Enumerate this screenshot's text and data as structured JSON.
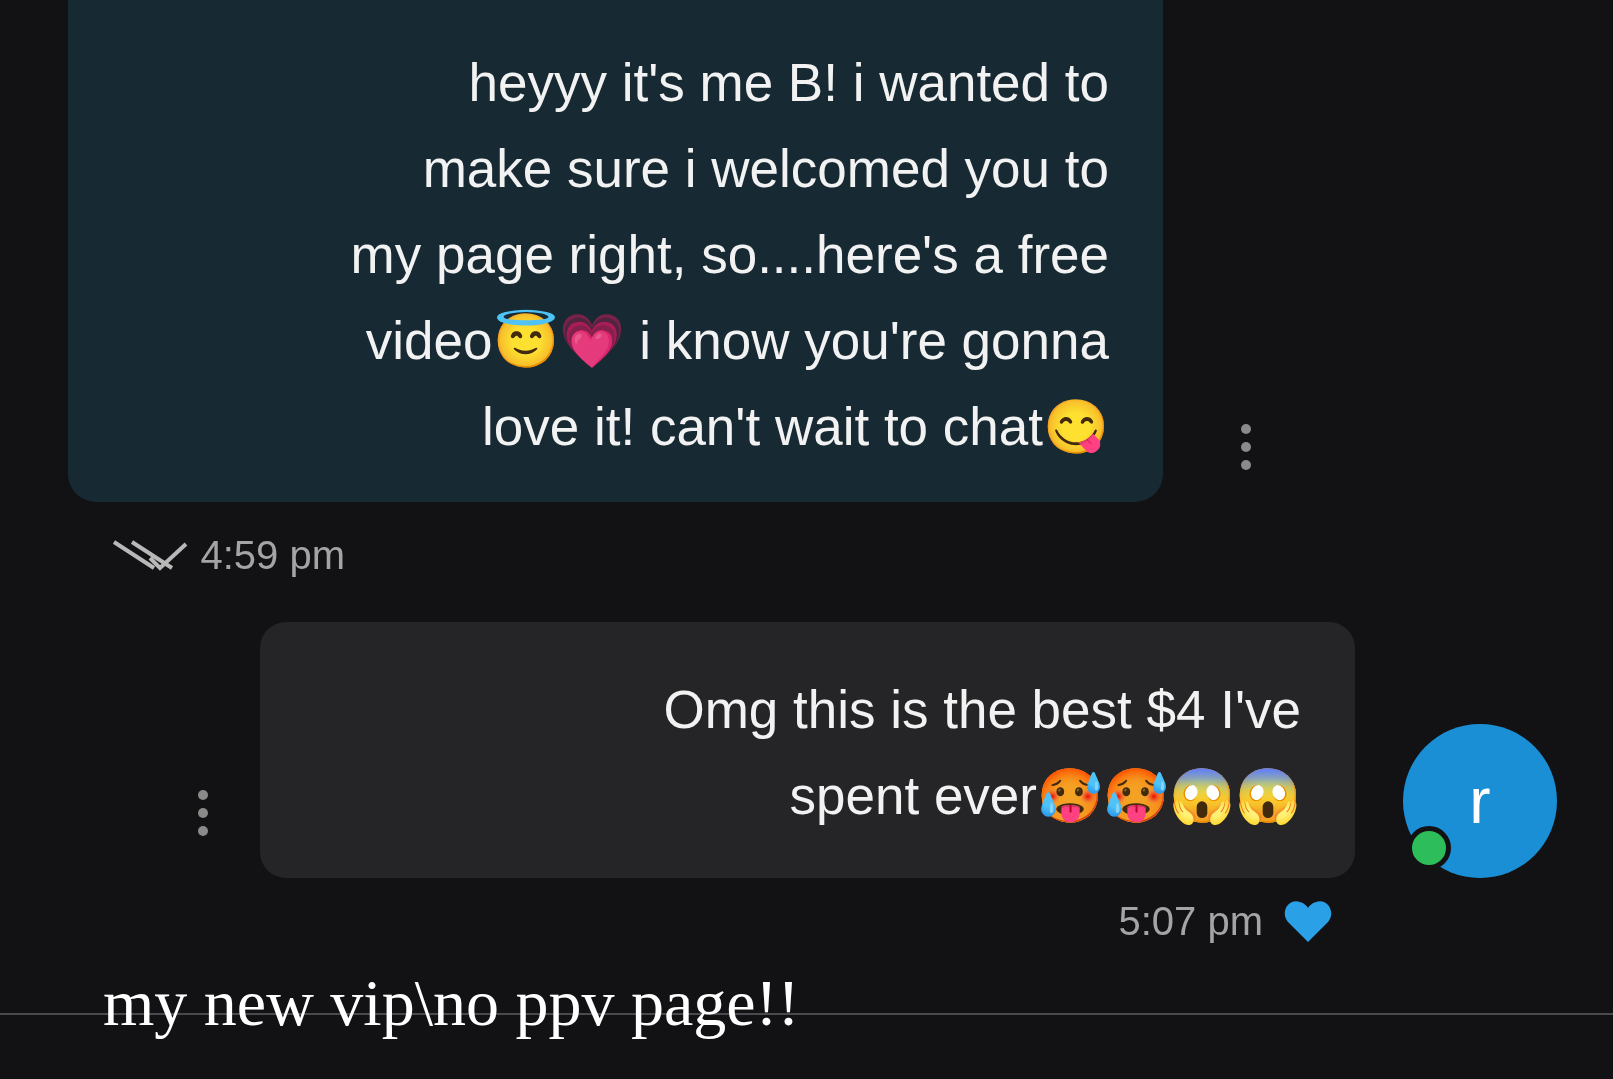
{
  "messages": [
    {
      "kind": "received",
      "text": "heyyy it's me B! i wanted to\nmake sure i welcomed you to\nmy page right, so....here's a free\nvideo😇💗 i know you're gonna\nlove it! can't wait to chat😋",
      "time": "4:59 pm",
      "read": true
    },
    {
      "kind": "sent",
      "text": "Omg this is the best $4 I've\nspent ever🥵🥵😱😱",
      "time": "5:07 pm",
      "avatar": "r",
      "online": true,
      "liked": true
    }
  ],
  "caption": "my new vip\\no ppv page!!"
}
